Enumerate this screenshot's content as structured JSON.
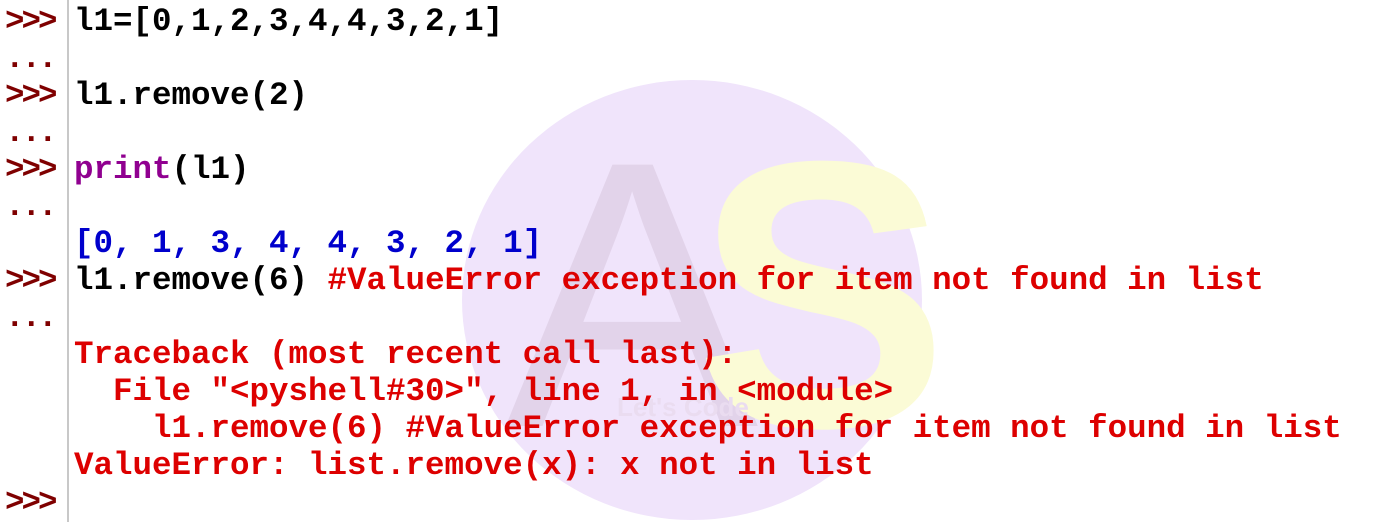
{
  "watermark": {
    "letters": "AS",
    "tagline": "Let's Code"
  },
  "colors": {
    "prompt": "#7f0000",
    "code": "#000000",
    "builtin": "#900090",
    "output": "#0000cc",
    "error": "#dd0000"
  },
  "lines": [
    {
      "prompt": ">>>",
      "parts": [
        {
          "t": "l1=[0,1,2,3,4,4,3,2,1]",
          "c": "k"
        }
      ]
    },
    {
      "prompt": "...",
      "parts": []
    },
    {
      "prompt": ">>>",
      "parts": [
        {
          "t": "l1.remove(2)",
          "c": "k"
        }
      ]
    },
    {
      "prompt": "...",
      "parts": []
    },
    {
      "prompt": ">>>",
      "parts": [
        {
          "t": "print",
          "c": "fn"
        },
        {
          "t": "(l1)",
          "c": "k"
        }
      ]
    },
    {
      "prompt": "...",
      "parts": []
    },
    {
      "prompt": "",
      "parts": [
        {
          "t": "[0, 1, 3, 4, 4, 3, 2, 1]",
          "c": "out"
        }
      ]
    },
    {
      "prompt": ">>>",
      "parts": [
        {
          "t": "l1.remove(6) ",
          "c": "k"
        },
        {
          "t": "#ValueError exception for item not found in list",
          "c": "err"
        }
      ]
    },
    {
      "prompt": "...",
      "parts": []
    },
    {
      "prompt": "",
      "parts": [
        {
          "t": "Traceback (most recent call last):",
          "c": "err"
        }
      ]
    },
    {
      "prompt": "",
      "parts": [
        {
          "t": "  File \"<pyshell#30>\", line 1, in <module>",
          "c": "err"
        }
      ]
    },
    {
      "prompt": "",
      "parts": [
        {
          "t": "    l1.remove(6) #ValueError exception for item not found in list",
          "c": "err"
        }
      ]
    },
    {
      "prompt": "",
      "parts": [
        {
          "t": "ValueError: list.remove(x): x not in list",
          "c": "err"
        }
      ]
    },
    {
      "prompt": ">>>",
      "parts": []
    }
  ]
}
